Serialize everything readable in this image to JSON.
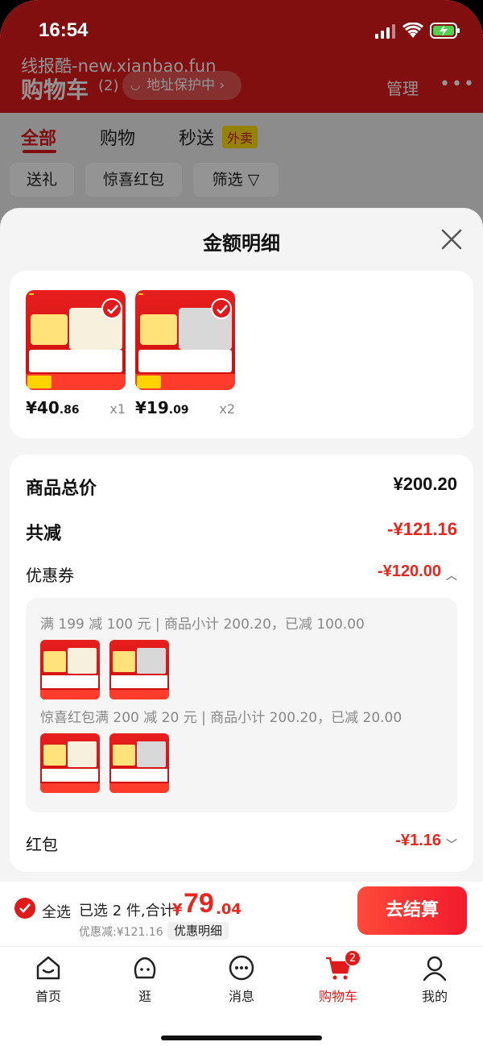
{
  "status_bar": {
    "time": "16:54"
  },
  "background": {
    "watermark": "线报酷-new.xianbao.fun",
    "title": "购物车",
    "count": "(2)",
    "address_pill": "地址保护中 ›",
    "manage": "管理",
    "more": "•••",
    "tabs": {
      "all": "全部",
      "shopping": "购物",
      "quick": "秒送",
      "takeout_badge": "外卖"
    },
    "chips": [
      "送礼",
      "惊喜红包",
      "筛选 ▽"
    ]
  },
  "sheet": {
    "title": "金额明细",
    "products": [
      {
        "price_int": "¥40",
        "price_dec": ".86",
        "qty": "x1"
      },
      {
        "price_int": "¥19",
        "price_dec": ".09",
        "qty": "x2"
      }
    ],
    "total_label": "商品总价",
    "total_value": "¥200.20",
    "reduce_label": "共减",
    "reduce_value": "-¥121.16",
    "coupon_label": "优惠券",
    "coupon_value": "-¥120.00",
    "coupon_lines": [
      "满 199 减 100 元 | 商品小计 200.20，已减 100.00",
      "惊喜红包满 200 减 20 元 | 商品小计 200.20，已减 20.00"
    ],
    "redpacket_label": "红包",
    "redpacket_value": "-¥1.16"
  },
  "checkout": {
    "select_all": "全选",
    "summary": "已选 2 件,合计:",
    "currency": "¥",
    "total_int": "79",
    "total_dec": ".04",
    "discount": "优惠减:¥121.16",
    "detail_button": "优惠明细",
    "pay_button": "去结算"
  },
  "tabbar": {
    "items": [
      {
        "label": "首页",
        "icon": "home-icon"
      },
      {
        "label": "逛",
        "icon": "browse-icon"
      },
      {
        "label": "消息",
        "icon": "message-icon"
      },
      {
        "label": "购物车",
        "icon": "cart-icon",
        "badge": "2"
      },
      {
        "label": "我的",
        "icon": "profile-icon"
      }
    ]
  },
  "colors": {
    "accent": "#e01a1a",
    "price_red": "#e8261c"
  }
}
